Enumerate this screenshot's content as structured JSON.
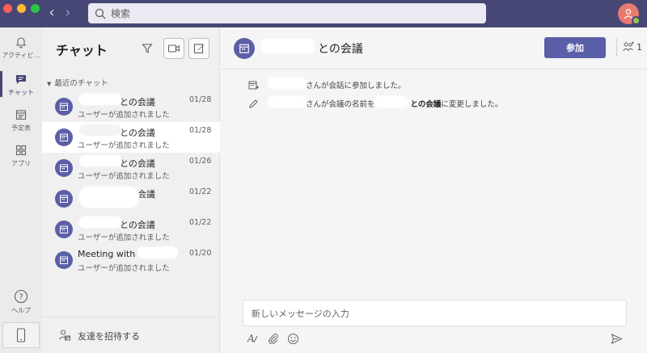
{
  "search": {
    "placeholder": "検索"
  },
  "rail": {
    "items": [
      {
        "label": "アクティビ…",
        "icon": "bell-icon"
      },
      {
        "label": "チャット",
        "icon": "chat-icon"
      },
      {
        "label": "予定表",
        "icon": "calendar-icon"
      },
      {
        "label": "アプリ",
        "icon": "apps-icon"
      }
    ],
    "help_label": "ヘルプ"
  },
  "chat_list": {
    "title": "チャット",
    "section_label": "最近のチャット",
    "items": [
      {
        "name": "との会議",
        "preview": "ユーザーが追加されました",
        "date": "01/28"
      },
      {
        "name": "との会議",
        "preview": "ユーザーが追加されました",
        "date": "01/28"
      },
      {
        "name": "との会議",
        "preview": "ユーザーが追加されました",
        "date": "01/26"
      },
      {
        "name": "会議",
        "preview": "",
        "date": "01/22"
      },
      {
        "name": "との会議",
        "preview": "ユーザーが追加されました",
        "date": "01/22"
      },
      {
        "name": "Meeting with",
        "preview": "ユーザーが追加されました",
        "date": "01/20"
      }
    ],
    "invite_label": "友達を招待する"
  },
  "main": {
    "title": "との会議",
    "join_label": "参加",
    "participant_count": "1",
    "events": [
      {
        "text": "さんが会話に参加しました。"
      },
      {
        "prefix": "さんが会議の名前を",
        "bold": "との会議",
        "suffix": "に変更しました。"
      }
    ],
    "compose_placeholder": "新しいメッセージの入力"
  },
  "colors": {
    "titlebar": "#464775",
    "accent": "#5b5fa7",
    "avatar": "#e97a6f",
    "status": "#92c353"
  }
}
